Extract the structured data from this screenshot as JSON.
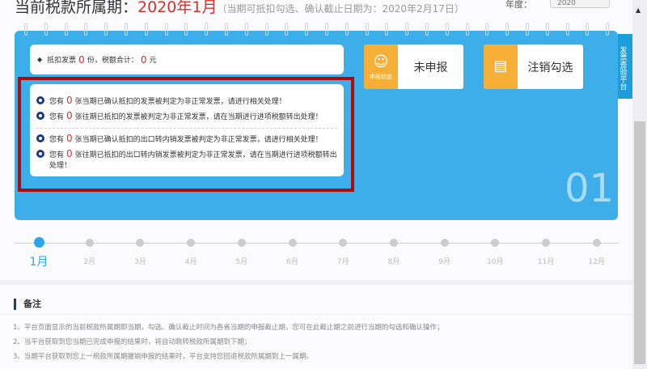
{
  "header": {
    "title_prefix": "当前税款所属期：",
    "period": "2020年1月",
    "hint": "（当期可抵扣勾选、确认截止日期为：2020年2月17日）",
    "year_label": "年度：",
    "year_value": "2020"
  },
  "info": {
    "prefix": "抵扣发票",
    "count": "0",
    "mid": "份，税额合计：",
    "amount": "0",
    "suffix": "元"
  },
  "alerts": [
    {
      "a": "您有",
      "n": "0",
      "b": "张当期已确认抵扣的发票被判定为非正常发票，请进行相关处理！"
    },
    {
      "a": "您有",
      "n": "0",
      "b": "张往期已抵扣的发票被判定为非正常发票，请在当期进行进项税额转出处理！"
    },
    {
      "a": "您有",
      "n": "0",
      "b": "张当期已确认抵扣的出口转内销发票被判定为非正常发票，请进行相关处理！"
    },
    {
      "a": "您有",
      "n": "0",
      "b": "张往期已抵扣的出口转内销发票被判定为非正常发票，请在当期进行进项税额转出处理！"
    }
  ],
  "status": {
    "icon_label": "申报状态",
    "value": "未申报"
  },
  "cancel": {
    "label": "注销勾选"
  },
  "big_month": "01",
  "side_tab": {
    "arrow": "<",
    "label": "发票查验平台"
  },
  "months": [
    "1月",
    "2月",
    "3月",
    "4月",
    "5月",
    "6月",
    "7月",
    "8月",
    "9月",
    "10月",
    "11月",
    "12月"
  ],
  "notes": {
    "title": "备注",
    "items": [
      "1、平台页面显示的当前税款所属期即当期，勾选、确认截止时间为各省当期的申报截止期，您可在此截止期之前进行当期的勾选和确认操作；",
      "2、当平台获取到您当期已完成申报的结果时，将自动跳转税款所属期到下期；",
      "3、当期平台获取到您上一税款所属期撤销申报的结果时，平台支持您回退税款所属期到上一属期。"
    ]
  }
}
